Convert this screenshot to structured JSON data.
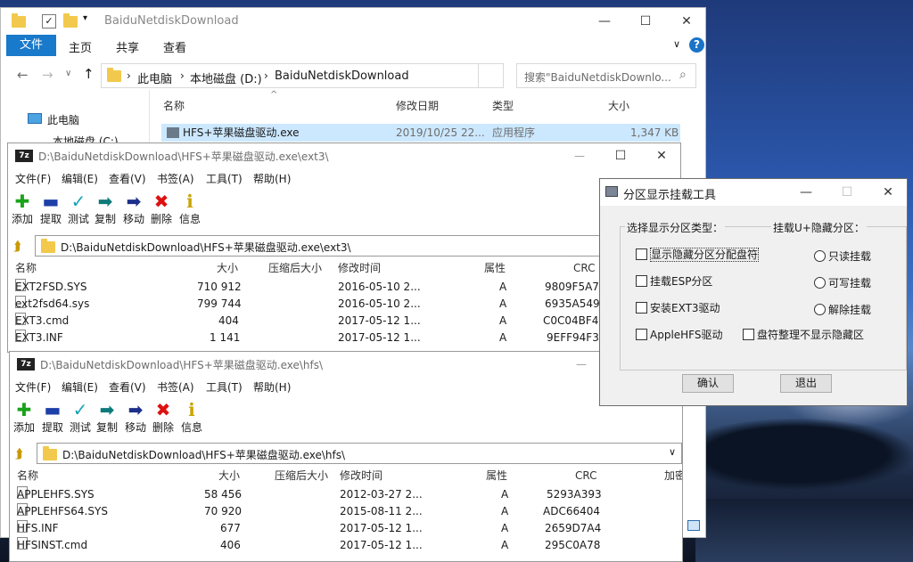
{
  "explorer": {
    "title": "BaiduNetdiskDownload",
    "tabs": {
      "file": "文件",
      "home": "主页",
      "share": "共享",
      "view": "查看"
    },
    "breadcrumb": {
      "pc": "此电脑",
      "drive": "本地磁盘 (D:)",
      "folder": "BaiduNetdiskDownload"
    },
    "search_placeholder": "搜索\"BaiduNetdiskDownlo...",
    "nav": {
      "pc": "此电脑",
      "drive": "本地磁盘 (C:)"
    },
    "columns": {
      "name": "名称",
      "date": "修改日期",
      "type": "类型",
      "size": "大小"
    },
    "file": {
      "name": "HFS+苹果磁盘驱动.exe",
      "date": "2019/10/25 22...",
      "type": "应用程序",
      "size": "1,347 KB"
    }
  },
  "zip1": {
    "title": "D:\\BaiduNetdiskDownload\\HFS+苹果磁盘驱动.exe\\ext3\\",
    "app_icon": "7z",
    "menu": [
      "文件(F)",
      "编辑(E)",
      "查看(V)",
      "书签(A)",
      "工具(T)",
      "帮助(H)"
    ],
    "toolbar": [
      "添加",
      "提取",
      "测试",
      "复制",
      "移动",
      "删除",
      "信息"
    ],
    "path": "D:\\BaiduNetdiskDownload\\HFS+苹果磁盘驱动.exe\\ext3\\",
    "columns": {
      "name": "名称",
      "size": "大小",
      "packed": "压缩后大小",
      "modified": "修改时间",
      "attr": "属性",
      "crc": "CRC"
    },
    "rows": [
      {
        "name": "EXT2FSD.SYS",
        "size": "710 912",
        "modified": "2016-05-10 2...",
        "attr": "A",
        "crc": "9809F5A7"
      },
      {
        "name": "ext2fsd64.sys",
        "size": "799 744",
        "modified": "2016-05-10 2...",
        "attr": "A",
        "crc": "6935A549"
      },
      {
        "name": "EXT3.cmd",
        "size": "404",
        "modified": "2017-05-12 1...",
        "attr": "A",
        "crc": "C0C04BF4"
      },
      {
        "name": "EXT3.INF",
        "size": "1 141",
        "modified": "2017-05-12 1...",
        "attr": "A",
        "crc": "9EFF94F3"
      }
    ]
  },
  "zip2": {
    "title": "D:\\BaiduNetdiskDownload\\HFS+苹果磁盘驱动.exe\\hfs\\",
    "app_icon": "7z",
    "menu": [
      "文件(F)",
      "编辑(E)",
      "查看(V)",
      "书签(A)",
      "工具(T)",
      "帮助(H)"
    ],
    "toolbar": [
      "添加",
      "提取",
      "测试",
      "复制",
      "移动",
      "删除",
      "信息"
    ],
    "path": "D:\\BaiduNetdiskDownload\\HFS+苹果磁盘驱动.exe\\hfs\\",
    "columns": {
      "name": "名称",
      "size": "大小",
      "packed": "压缩后大小",
      "modified": "修改时间",
      "attr": "属性",
      "crc": "CRC",
      "extra": "加密"
    },
    "rows": [
      {
        "name": "APPLEHFS.SYS",
        "size": "58 456",
        "modified": "2012-03-27 2...",
        "attr": "A",
        "crc": "5293A393"
      },
      {
        "name": "APPLEHFS64.SYS",
        "size": "70 920",
        "modified": "2015-08-11 2...",
        "attr": "A",
        "crc": "ADC66404"
      },
      {
        "name": "HFS.INF",
        "size": "677",
        "modified": "2017-05-12 1...",
        "attr": "A",
        "crc": "2659D7A4"
      },
      {
        "name": "HFSINST.cmd",
        "size": "406",
        "modified": "2017-05-12 1...",
        "attr": "A",
        "crc": "295C0A78"
      }
    ]
  },
  "dialog": {
    "title": "分区显示挂载工具",
    "group_left": "选择显示分区类型：",
    "group_right": "挂载U+隐藏分区：",
    "checks": [
      "显示隐藏分区分配盘符",
      "挂载ESP分区",
      "安装EXT3驱动",
      "AppleHFS驱动"
    ],
    "check_extra": "盘符整理不显示隐藏区",
    "radios": [
      "只读挂载",
      "可写挂载",
      "解除挂载"
    ],
    "ok": "确认",
    "exit": "退出"
  },
  "colors": {
    "ribbon_blue": "#1979ca",
    "selection": "#cce8ff",
    "accent_help": "#1a73c8"
  }
}
